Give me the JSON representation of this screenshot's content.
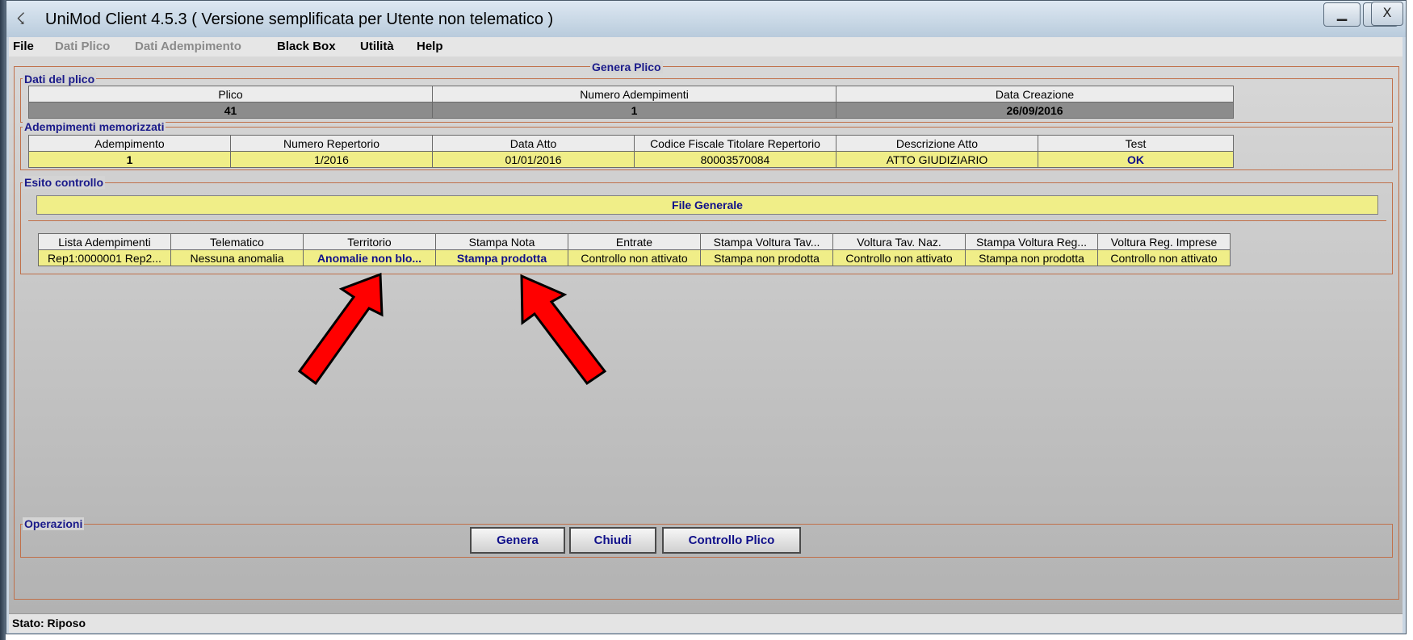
{
  "window": {
    "title": "UniMod Client  4.5.3  ( Versione semplificata per Utente non telematico )",
    "app_icon": "☇",
    "minimize_glyph": "▁",
    "maximize_glyph": "□",
    "close_glyph": "X"
  },
  "menu": [
    "File",
    "Dati Plico",
    "Dati Adempimento",
    "Black Box",
    "Utilità",
    "Help"
  ],
  "main": {
    "group_title": "Genera Plico",
    "plico": {
      "title": "Dati del plico",
      "headers": [
        "Plico",
        "Numero Adempimenti",
        "Data Creazione"
      ],
      "values": [
        "41",
        "1",
        "26/09/2016"
      ]
    },
    "adempimenti": {
      "title": "Adempimenti memorizzati",
      "headers": [
        "Adempimento",
        "Numero Repertorio",
        "Data Atto",
        "Codice Fiscale Titolare Repertorio",
        "Descrizione Atto",
        "Test"
      ],
      "values": [
        "1",
        "1/2016",
        "01/01/2016",
        "80003570084",
        "ATTO GIUDIZIARIO",
        "OK"
      ]
    },
    "esito": {
      "title": "Esito controllo",
      "file_generale": "File Generale",
      "headers": [
        "Lista Adempimenti",
        "Telematico",
        "Territorio",
        "Stampa Nota",
        "Entrate",
        "Stampa Voltura Tav...",
        "Voltura Tav. Naz.",
        "Stampa Voltura Reg...",
        "Voltura Reg. Imprese"
      ],
      "values": [
        "Rep1:0000001 Rep2...",
        "Nessuna anomalia",
        "Anomalie non blo...",
        "Stampa prodotta",
        "Controllo non attivato",
        "Stampa non prodotta",
        "Controllo non attivato",
        "Stampa non prodotta",
        "Controllo non attivato"
      ]
    },
    "operazioni": {
      "title": "Operazioni",
      "buttons": [
        "Genera",
        "Chiudi",
        "Controllo Plico"
      ]
    }
  },
  "status": "Stato: Riposo",
  "colors": {
    "arrow": "#ff0000",
    "highlight_row": "#f0ee88",
    "group_border": "#c0704a"
  }
}
